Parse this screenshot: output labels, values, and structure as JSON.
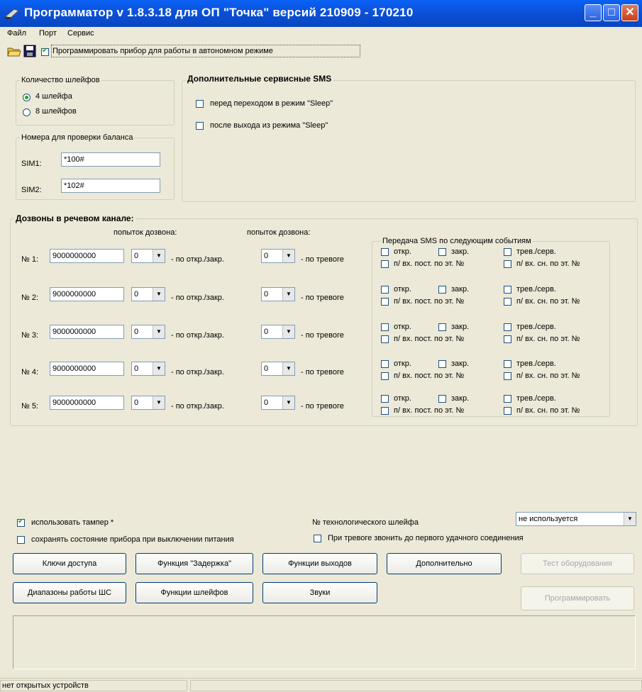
{
  "window": {
    "title": "Программатор v 1.8.3.18 для ОП \"Точка\" версий 210909 - 170210"
  },
  "menu": [
    "Файл",
    "Порт",
    "Сервис"
  ],
  "toolbar": {
    "autonomous_label": "Программировать прибор для работы в автономном режиме",
    "autonomous_checked": true
  },
  "loops": {
    "title": "Количество шлейфов",
    "opt4": "4 шлейфа",
    "opt8": "8 шлейфов"
  },
  "balance": {
    "title": "Номера для проверки баланса",
    "sim1_label": "SIM1:",
    "sim1_value": "*100#",
    "sim2_label": "SIM2:",
    "sim2_value": "*102#"
  },
  "sms_extra": {
    "title": "Дополнительные сервисные SMS",
    "before_sleep": "перед переходом в режим \"Sleep\"",
    "after_sleep": "после выхода из режима \"Sleep\""
  },
  "calls": {
    "title": "Дозвоны в речевом канале:",
    "attempts_header": "попыток дозвона:",
    "open_close_label": "- по откр./закр.",
    "alarm_label": "- по тревоге",
    "sms_title": "Передача SMS по следующим событиям",
    "sms_open": "откр.",
    "sms_close": "закр.",
    "sms_alarm": "трев./серв.",
    "sms_const": "п/ вх. пост. по эт. №",
    "sms_night": "п/ вх. сн. по эт. №",
    "rows": [
      {
        "label": "№ 1:",
        "phone": "9000000000",
        "a1": "0",
        "a2": "0",
        "sms_open": "откр.",
        "sms_close": "закр.",
        "sms_alarm": "трев./серв.",
        "sms_const": "п/ вх. пост. по эт. №",
        "sms_night": "п/ вх. сн. по эт. №"
      },
      {
        "label": "№ 2:",
        "phone": "9000000000",
        "a1": "0",
        "a2": "0",
        "sms_open": "откр.",
        "sms_close": "закр.",
        "sms_alarm": "трев./серв.",
        "sms_const": "п/ вх. пост. по эт. №",
        "sms_night": "п/ вх. сн. по эт. №"
      },
      {
        "label": "№ 3:",
        "phone": "9000000000",
        "a1": "0",
        "a2": "0",
        "sms_open": "откр.",
        "sms_close": "закр.",
        "sms_alarm": "трев./серв.",
        "sms_const": "п/ вх. пост. по эт. №",
        "sms_night": "п/ вх. сн. по эт. №"
      },
      {
        "label": "№ 4:",
        "phone": "9000000000",
        "a1": "0",
        "a2": "0",
        "sms_open": "откр.",
        "sms_close": "закр.",
        "sms_alarm": "трев./серв.",
        "sms_const": "п/ вх. пост. по эт. №",
        "sms_night": "п/ вх. сн. по эт. №"
      },
      {
        "label": "№ 5:",
        "phone": "9000000000",
        "a1": "0",
        "a2": "0",
        "sms_open": "откр.",
        "sms_close": "закр.",
        "sms_alarm": "трев./серв.",
        "sms_const": "п/ вх. пост. по эт. №",
        "sms_night": "п/ вх. сн. по эт. №"
      }
    ]
  },
  "options": {
    "tamper": "использовать тампер *",
    "save_state": "сохранять состояние прибора при выключении питания",
    "tech_loop_label": "№ технологического шлейфа",
    "tech_loop_value": "не используется",
    "call_until": "При тревоге звонить до первого удачного соединения"
  },
  "buttons": {
    "access_keys": "Ключи доступа",
    "delay": "Функция \"Задержка\"",
    "outputs": "Функции выходов",
    "additional": "Дополнительно",
    "test": "Тест оборудования",
    "ranges": "Диапазоны работы ШС",
    "loop_functions": "Функции шлейфов",
    "sounds": "Звуки",
    "program": "Программировать"
  },
  "status": {
    "text": "нет открытых устройств"
  }
}
